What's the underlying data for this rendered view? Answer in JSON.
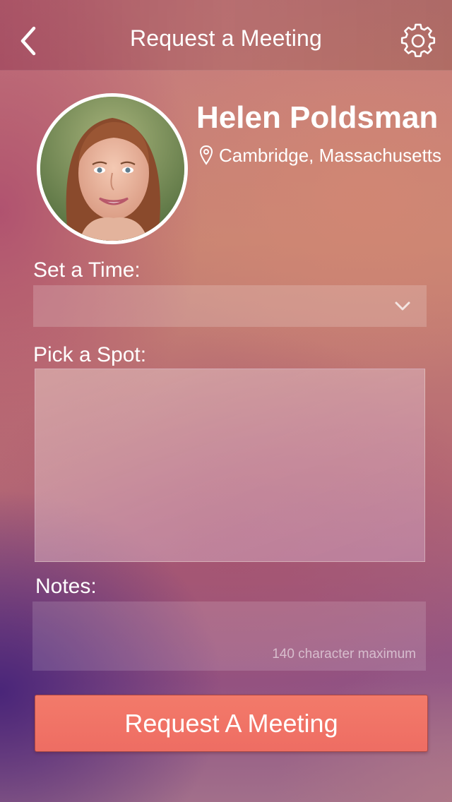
{
  "header": {
    "title": "Request a Meeting",
    "back_icon": "chevron-left-icon",
    "settings_icon": "gear-icon"
  },
  "profile": {
    "name": "Helen Poldsman",
    "location": "Cambridge, Massachusetts",
    "location_icon": "map-pin-icon"
  },
  "form": {
    "time_label": "Set a Time:",
    "time_value": "",
    "spot_label": "Pick a Spot:",
    "notes_label": "Notes:",
    "notes_placeholder": "140 character maximum",
    "submit_label": "Request A Meeting"
  },
  "colors": {
    "accent": "#f07266",
    "text": "#ffffff"
  }
}
